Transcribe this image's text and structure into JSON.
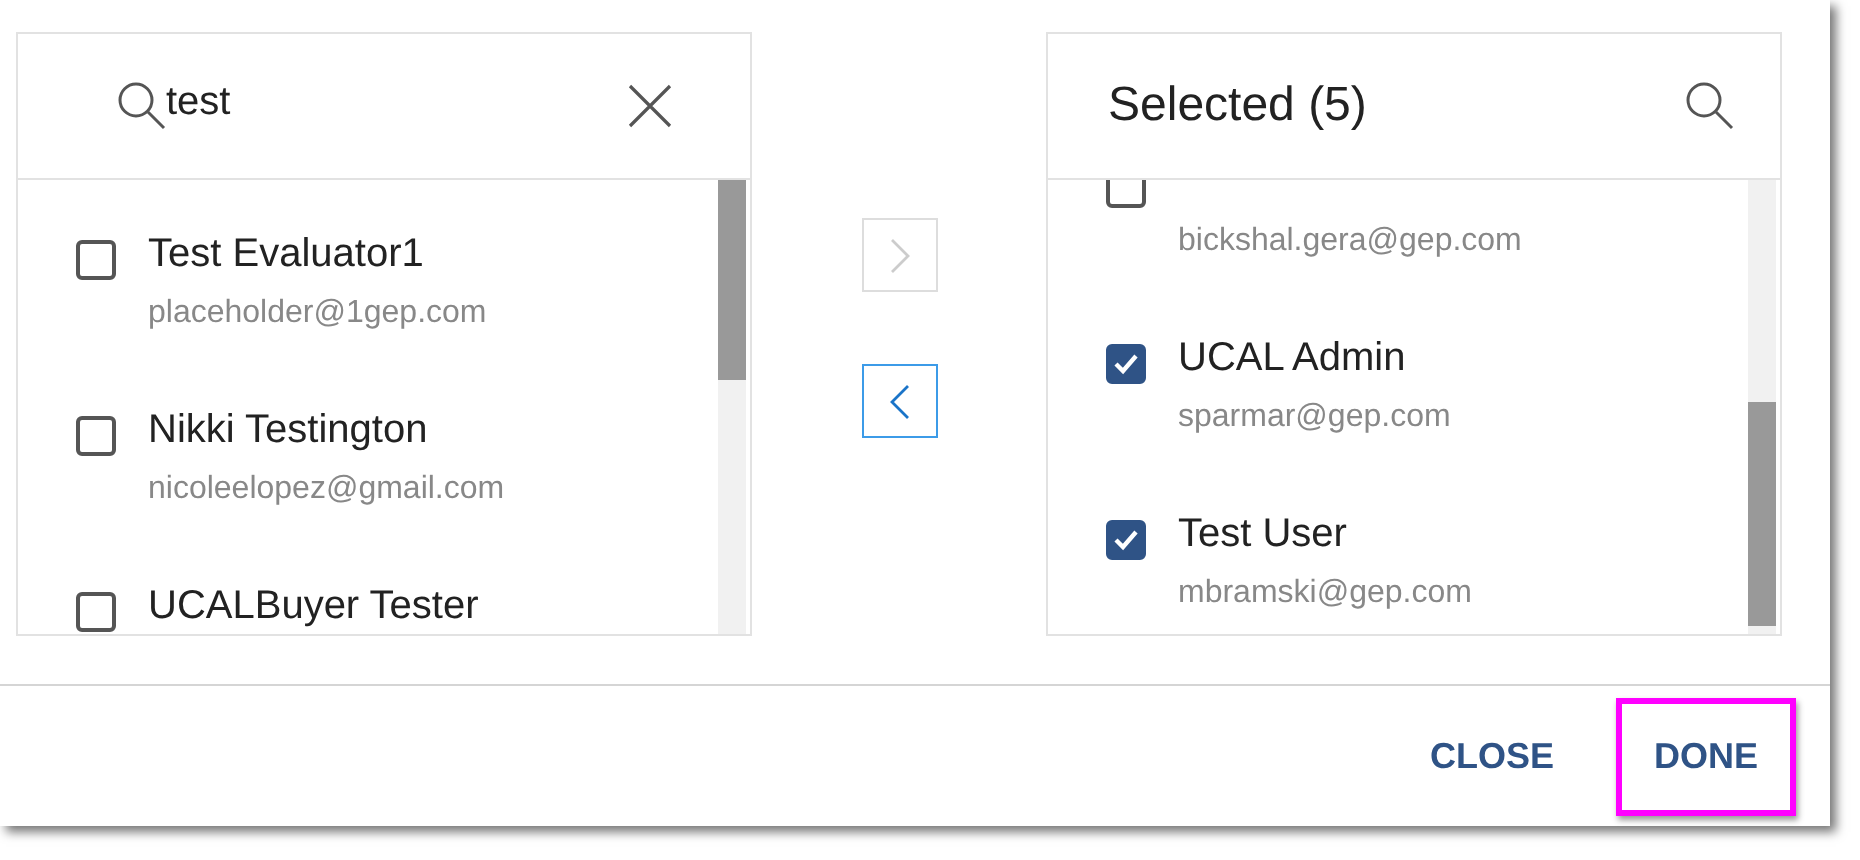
{
  "available": {
    "search": {
      "value": "test"
    },
    "items": [
      {
        "name": "Test Evaluator1",
        "email": "placeholder@1gep.com",
        "checked": false
      },
      {
        "name": "Nikki Testington",
        "email": "nicoleelopez@gmail.com",
        "checked": false
      },
      {
        "name": "UCALBuyer Tester",
        "checked": false
      }
    ]
  },
  "transfer_buttons": [
    {
      "kind": "right",
      "disabled": true
    },
    {
      "kind": "left",
      "disabled": false
    }
  ],
  "selected": {
    "title": "Selected (5)",
    "items": [
      {
        "email": "bickshal.gera@gep.com",
        "checked": false
      },
      {
        "name": "UCAL Admin",
        "email": "sparmar@gep.com",
        "checked": true
      },
      {
        "name": "Test User",
        "email": "mbramski@gep.com",
        "checked": true
      }
    ]
  },
  "footer": {
    "buttons": [
      {
        "label": "CLOSE",
        "highlighted": false
      },
      {
        "label": "DONE",
        "highlighted": true
      }
    ]
  }
}
